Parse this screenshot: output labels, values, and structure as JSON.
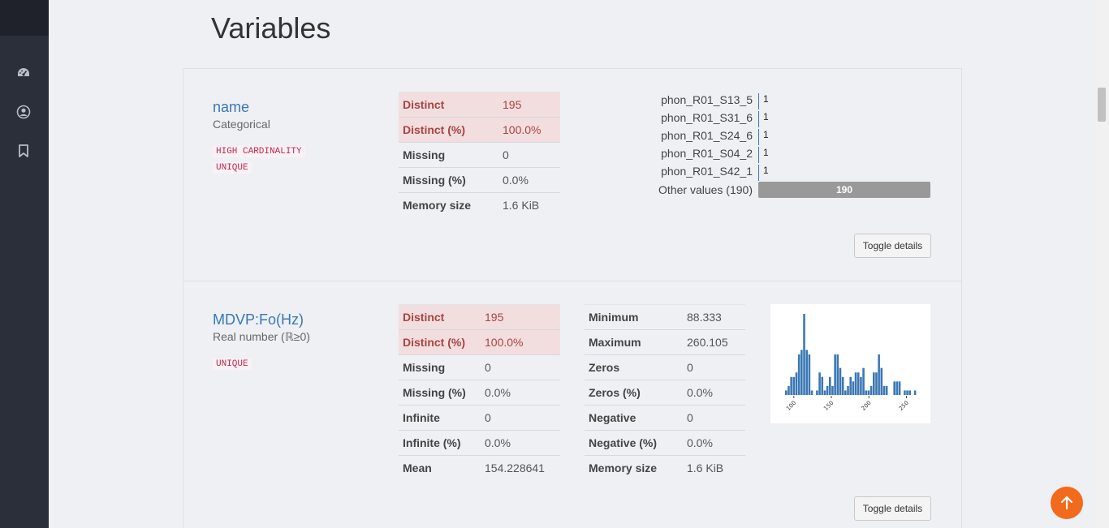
{
  "page": {
    "title": "Variables"
  },
  "sidebar": {
    "icons": [
      "dashboard-icon",
      "user-icon",
      "bookmark-icon"
    ]
  },
  "colors": {
    "sidebar": "#2b2f3a",
    "link": "#3a77b5",
    "alert_text": "#a94442",
    "alert_bg": "#f2dede",
    "badge": "#c7254e",
    "fab": "#f26a1b",
    "bar": "#3a77b5"
  },
  "variables": [
    {
      "name": "name",
      "type": "Categorical",
      "badges": [
        "HIGH CARDINALITY",
        "UNIQUE"
      ],
      "stats": [
        {
          "k": "Distinct",
          "v": "195"
        },
        {
          "k": "Distinct (%)",
          "v": "100.0%"
        },
        {
          "k": "Missing",
          "v": "0"
        },
        {
          "k": "Missing (%)",
          "v": "0.0%"
        },
        {
          "k": "Memory size",
          "v": "1.6 KiB"
        }
      ],
      "freq": [
        {
          "label": "phon_R01_S13_5",
          "count": "1"
        },
        {
          "label": "phon_R01_S31_6",
          "count": "1"
        },
        {
          "label": "phon_R01_S24_6",
          "count": "1"
        },
        {
          "label": "phon_R01_S04_2",
          "count": "1"
        },
        {
          "label": "phon_R01_S42_1",
          "count": "1"
        }
      ],
      "other_label": "Other values (190)",
      "other_count": "190",
      "toggle": "Toggle details"
    },
    {
      "name": "MDVP:Fo(Hz)",
      "type": "Real number (ℝ≥0)",
      "badges": [
        "UNIQUE"
      ],
      "stats": [
        {
          "k": "Distinct",
          "v": "195"
        },
        {
          "k": "Distinct (%)",
          "v": "100.0%"
        },
        {
          "k": "Missing",
          "v": "0"
        },
        {
          "k": "Missing (%)",
          "v": "0.0%"
        },
        {
          "k": "Infinite",
          "v": "0"
        },
        {
          "k": "Infinite (%)",
          "v": "0.0%"
        },
        {
          "k": "Mean",
          "v": "154.228641"
        }
      ],
      "stats2": [
        {
          "k": "Minimum",
          "v": "88.333"
        },
        {
          "k": "Maximum",
          "v": "260.105"
        },
        {
          "k": "Zeros",
          "v": "0"
        },
        {
          "k": "Zeros (%)",
          "v": "0.0%"
        },
        {
          "k": "Negative",
          "v": "0"
        },
        {
          "k": "Negative (%)",
          "v": "0.0%"
        },
        {
          "k": "Memory size",
          "v": "1.6 KiB"
        }
      ],
      "toggle": "Toggle details"
    }
  ],
  "chart_data": {
    "type": "bar",
    "x_ticks": [
      "100",
      "150",
      "200",
      "250"
    ],
    "bin_start": 88.333,
    "bin_width": 3.435,
    "values": [
      1,
      2,
      4,
      4,
      5,
      9,
      10,
      18,
      10,
      9,
      1,
      0,
      1,
      5,
      4,
      1,
      2,
      4,
      2,
      9,
      9,
      6,
      4,
      1,
      2,
      4,
      3,
      5,
      5,
      4,
      6,
      1,
      1,
      2,
      5,
      5,
      9,
      6,
      2,
      2,
      0,
      0,
      3,
      3,
      3,
      0,
      1,
      1,
      1,
      0,
      1
    ]
  }
}
